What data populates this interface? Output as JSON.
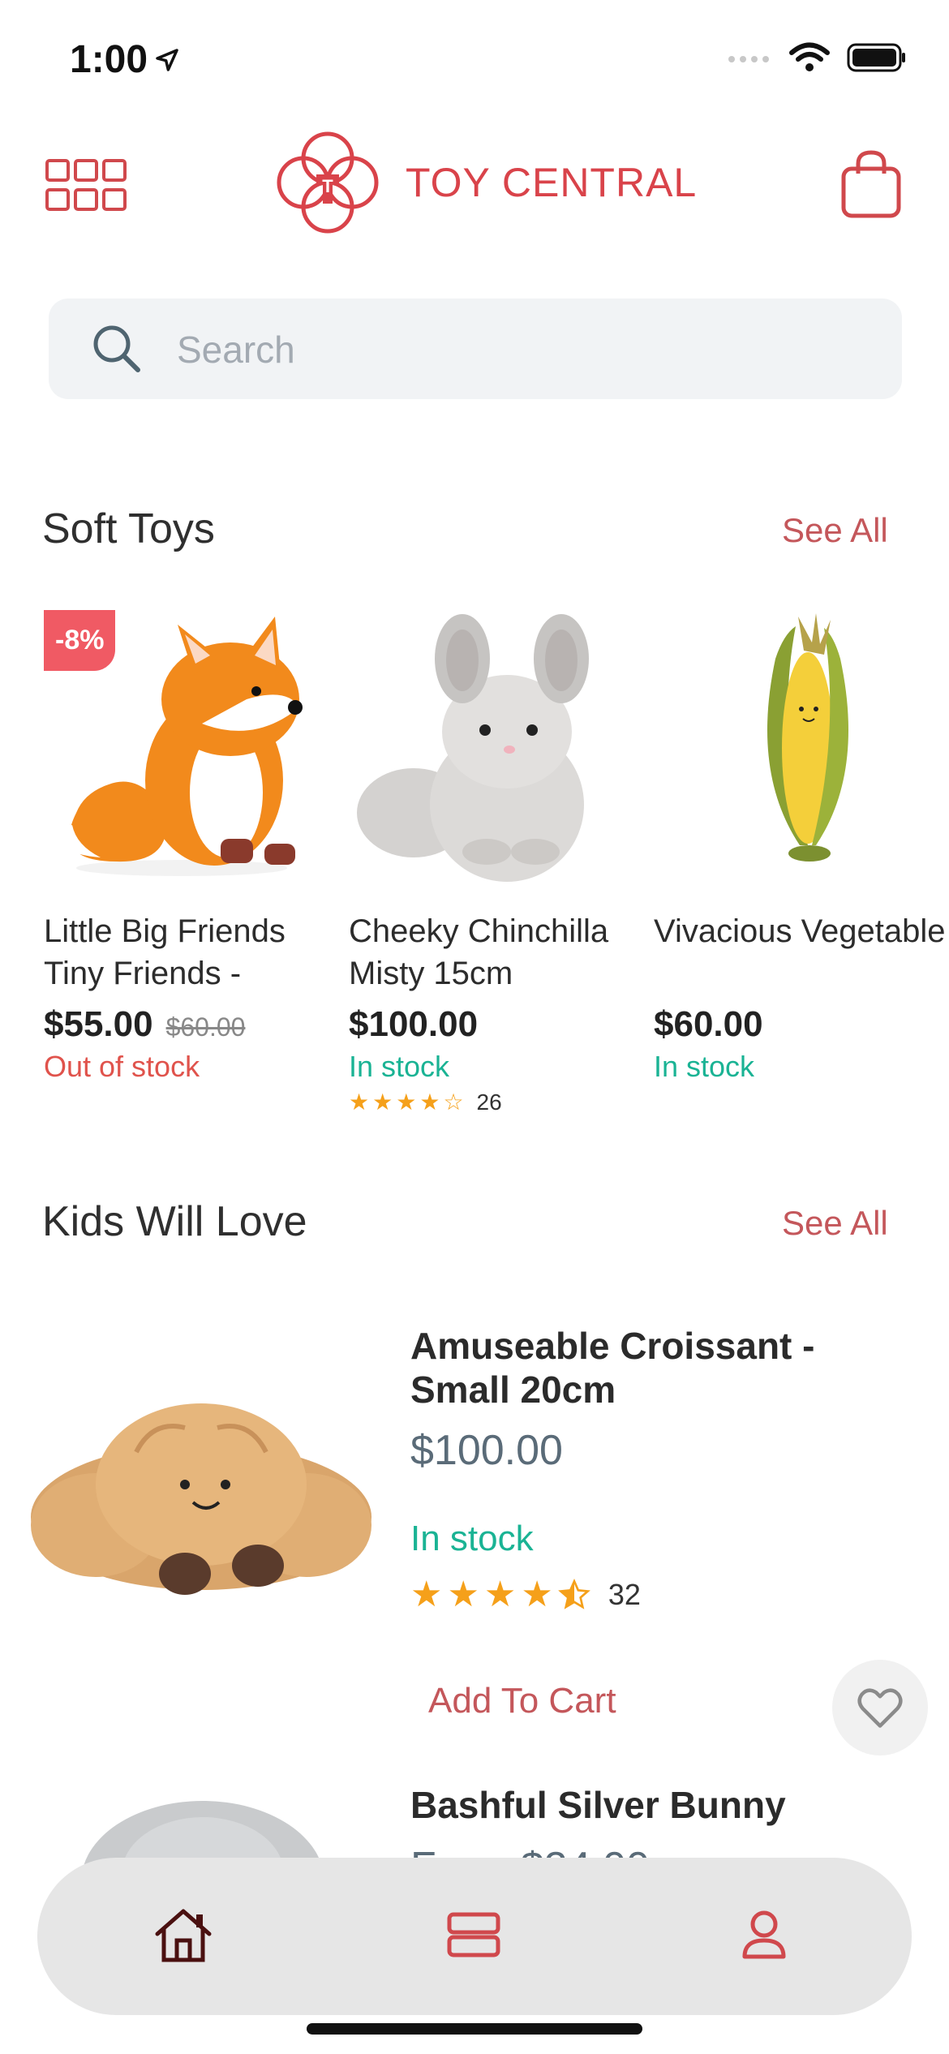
{
  "status": {
    "time": "1:00"
  },
  "brand": {
    "name": "TOY CENTRAL"
  },
  "search": {
    "placeholder": "Search"
  },
  "sections": {
    "soft_toys": {
      "title": "Soft Toys",
      "see_all": "See All"
    },
    "kids_love": {
      "title": "Kids Will Love",
      "see_all": "See All"
    }
  },
  "soft_toys": [
    {
      "badge": "-8%",
      "name": "Little Big Friends Tiny Friends -",
      "price": "$55.00",
      "old_price": "$60.00",
      "stock": "Out of stock"
    },
    {
      "name": "Cheeky Chinchilla Misty 15cm",
      "price": "$100.00",
      "stock": "In stock",
      "rating": 4,
      "reviews": "26"
    },
    {
      "name": "Vivacious Vegetable",
      "price": "$60.00",
      "stock": "In stock"
    }
  ],
  "kids_love": [
    {
      "name": "Amuseable Croissant - Small 20cm",
      "price": "$100.00",
      "stock": "In stock",
      "rating": 4.5,
      "reviews": "32",
      "add_to_cart": "Add To Cart"
    },
    {
      "name": "Bashful Silver Bunny",
      "price": "From $24.00"
    }
  ],
  "colors": {
    "accent": "#d9434a",
    "in_stock": "#1ab394",
    "out_of_stock": "#e0534c",
    "star": "#f5a01a"
  },
  "icons": [
    "location-arrow-icon",
    "grid-menu-icon",
    "toy-central-logo",
    "shopping-bag-icon",
    "search-icon",
    "heart-icon",
    "home-icon",
    "categories-icon",
    "profile-icon"
  ]
}
